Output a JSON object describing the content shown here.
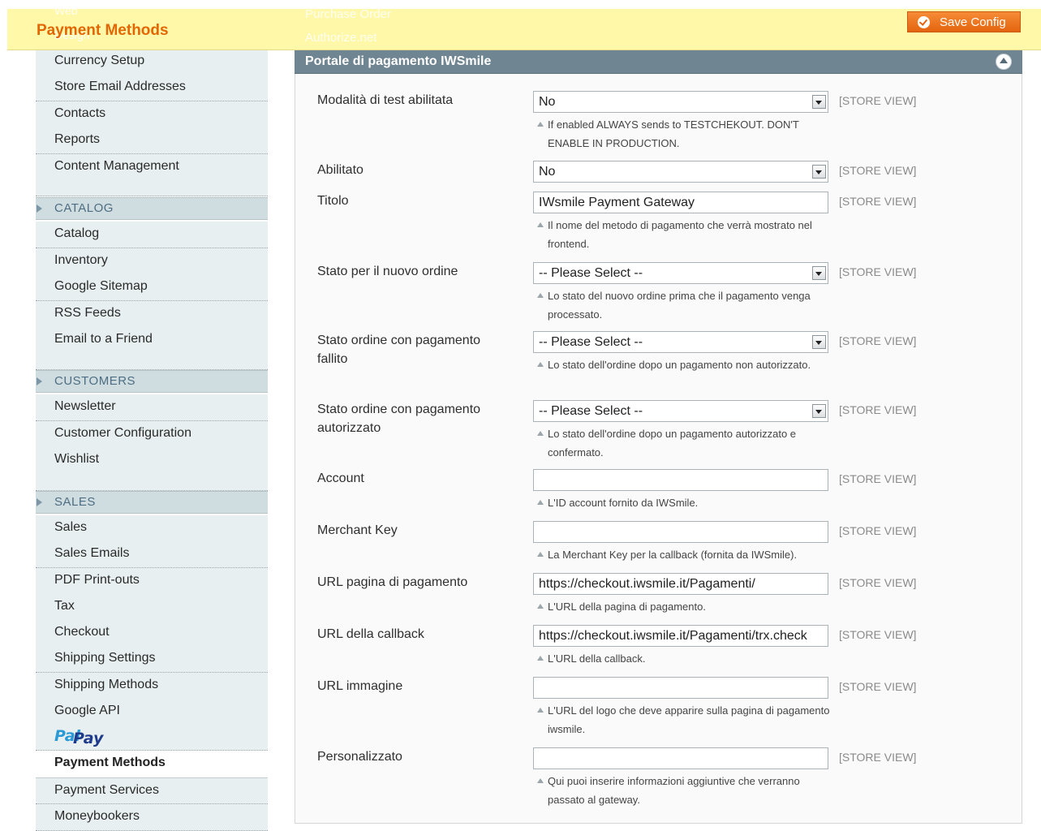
{
  "header": {
    "page_title": "Payment Methods",
    "save_label": "Save Config",
    "ghost_left_1": "Web",
    "ghost_left_2": "Design",
    "ghost_tab_1": "Purchase Order",
    "ghost_tab_2": "Authorize.net"
  },
  "sidebar": {
    "general_items": [
      "Currency Setup",
      "Store Email Addresses",
      "Contacts",
      "Reports",
      "Content Management"
    ],
    "catalog_title": "CATALOG",
    "catalog_items": [
      "Catalog",
      "Inventory",
      "Google Sitemap",
      "RSS Feeds",
      "Email to a Friend"
    ],
    "customers_title": "CUSTOMERS",
    "customers_items": [
      "Newsletter",
      "Customer Configuration",
      "Wishlist"
    ],
    "sales_title": "SALES",
    "sales_items": [
      "Sales",
      "Sales Emails",
      "PDF Print-outs",
      "Tax",
      "Checkout",
      "Shipping Settings",
      "Shipping Methods",
      "Google API"
    ],
    "paypal_logo": "PayPal",
    "active_item": "Payment Methods",
    "after_items": [
      "Payment Services",
      "Moneybookers"
    ]
  },
  "panel": {
    "title": "Portale di pagamento IWSmile",
    "fields": [
      {
        "label": "Modalità di test abilitata",
        "type": "select",
        "value": "No",
        "scope": "[STORE VIEW]",
        "note": "If enabled ALWAYS sends to TESTCHEKOUT. DON'T ENABLE IN PRODUCTION."
      },
      {
        "label": "Abilitato",
        "type": "select",
        "value": "No",
        "scope": "[STORE VIEW]",
        "note": ""
      },
      {
        "label": "Titolo",
        "type": "text",
        "value": "IWsmile Payment Gateway",
        "scope": "[STORE VIEW]",
        "note": "Il nome del metodo di pagamento che verrà mostrato nel frontend."
      },
      {
        "label": "Stato per il nuovo ordine",
        "type": "select",
        "value": "-- Please Select --",
        "scope": "[STORE VIEW]",
        "note": "Lo stato del nuovo ordine prima che il pagamento venga processato."
      },
      {
        "label": "Stato ordine con pagamento fallito",
        "type": "select",
        "value": "-- Please Select --",
        "scope": "[STORE VIEW]",
        "note": "Lo stato dell'ordine dopo un pagamento non autorizzato."
      },
      {
        "label": "Stato ordine con pagamento autorizzato",
        "type": "select",
        "value": "-- Please Select --",
        "scope": "[STORE VIEW]",
        "note": "Lo stato dell'ordine dopo un pagamento autorizzato e confermato."
      },
      {
        "label": "Account",
        "type": "text",
        "value": "",
        "scope": "[STORE VIEW]",
        "note": "L'ID account fornito da IWSmile."
      },
      {
        "label": "Merchant Key",
        "type": "text",
        "value": "",
        "scope": "[STORE VIEW]",
        "note": "La Merchant Key per la callback (fornita da IWSmile)."
      },
      {
        "label": "URL pagina di pagamento",
        "type": "text",
        "value": "https://checkout.iwsmile.it/Pagamenti/",
        "scope": "[STORE VIEW]",
        "note": "L'URL della pagina di pagamento."
      },
      {
        "label": "URL della callback",
        "type": "text",
        "value": "https://checkout.iwsmile.it/Pagamenti/trx.check",
        "scope": "[STORE VIEW]",
        "note": "L'URL della callback."
      },
      {
        "label": "URL immagine",
        "type": "text",
        "value": "",
        "scope": "[STORE VIEW]",
        "note": "L'URL del logo che deve apparire sulla pagina di pagamento iwsmile."
      },
      {
        "label": "Personalizzato",
        "type": "text",
        "value": "",
        "scope": "[STORE VIEW]",
        "note": "Qui puoi inserire informazioni aggiuntive che verranno passato al gateway."
      }
    ]
  }
}
